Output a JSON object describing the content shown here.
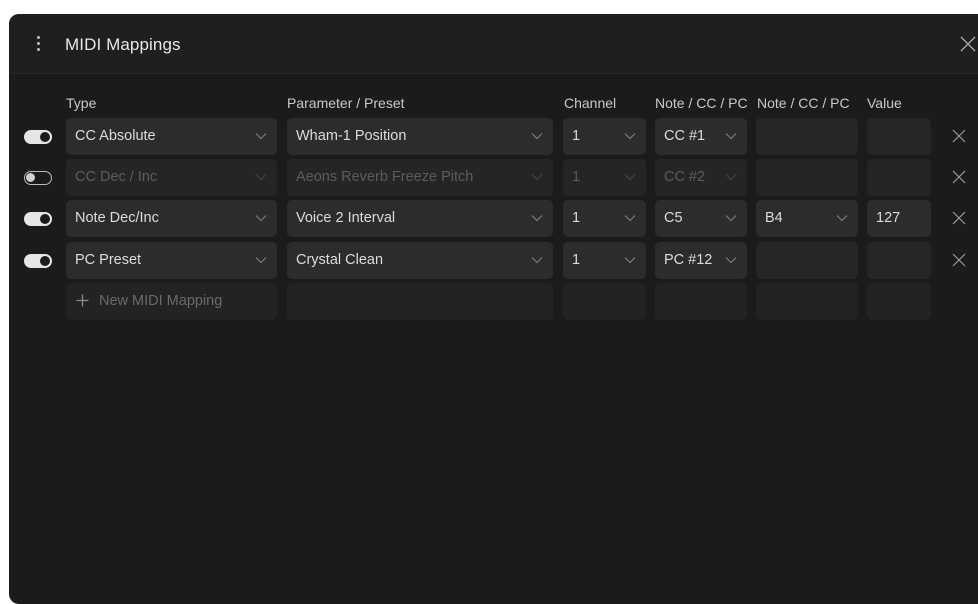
{
  "window": {
    "title": "MIDI Mappings"
  },
  "columns": {
    "type": "Type",
    "parameter": "Parameter / Preset",
    "channel": "Channel",
    "note1": "Note / CC / PC",
    "note2": "Note / CC / PC",
    "value": "Value"
  },
  "rows": [
    {
      "enabled": true,
      "type": "CC Absolute",
      "parameter": "Wham-1 Position",
      "channel": "1",
      "note1": "CC #1",
      "note2": "",
      "value": ""
    },
    {
      "enabled": false,
      "type": "CC Dec / Inc",
      "parameter": "Aeons Reverb Freeze Pitch",
      "channel": "1",
      "note1": "CC #2",
      "note2": "",
      "value": ""
    },
    {
      "enabled": true,
      "type": "Note Dec/Inc",
      "parameter": "Voice 2 Interval",
      "channel": "1",
      "note1": "C5",
      "note2": "B4",
      "value": "127"
    },
    {
      "enabled": true,
      "type": "PC Preset",
      "parameter": "Crystal Clean",
      "channel": "1",
      "note1": "PC #12",
      "note2": "",
      "value": ""
    }
  ],
  "new_mapping": {
    "label": "New MIDI Mapping"
  },
  "icons": {
    "menu": "kebab-menu-icon",
    "close": "close-icon",
    "dropdown": "chevron-down-icon",
    "toggle": "toggle-switch-icon",
    "remove": "remove-icon",
    "add": "plus-icon"
  },
  "colors": {
    "window_bg": "#1b1b1b",
    "titlebar_bg": "#1f1f1f",
    "cell_bg": "#2c2c2c",
    "text": "#dcdcdc",
    "disabled_text": "#5c5c5c"
  }
}
